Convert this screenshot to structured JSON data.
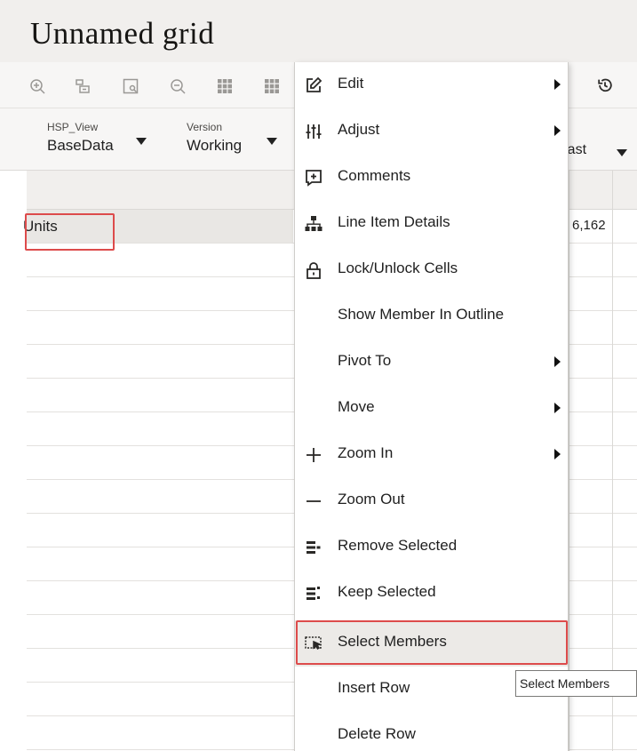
{
  "page": {
    "title": "Unnamed grid"
  },
  "toolbar": {
    "icons": [
      "zoom-in-icon",
      "keep-selected-icon",
      "select-icon",
      "zoom-out-icon",
      "grid-icon",
      "grid-icon",
      "refresh-history-icon"
    ]
  },
  "pov": {
    "items": [
      {
        "label": "HSP_View",
        "value": "BaseData"
      },
      {
        "label": "Version",
        "value": "Working"
      }
    ],
    "partial_value": "East"
  },
  "grid": {
    "row_label": "Units",
    "cell_value": "6,162"
  },
  "context_menu": {
    "items": [
      {
        "label": "Edit",
        "icon": "edit-icon",
        "submenu": true
      },
      {
        "label": "Adjust",
        "icon": "adjust-icon",
        "submenu": true
      },
      {
        "label": "Comments",
        "icon": "comments-icon",
        "submenu": false
      },
      {
        "label": "Line Item Details",
        "icon": "hierarchy-icon",
        "submenu": false
      },
      {
        "label": "Lock/Unlock Cells",
        "icon": "lock-icon",
        "submenu": false
      },
      {
        "label": "Show Member In Outline",
        "icon": "",
        "submenu": false
      },
      {
        "label": "Pivot To",
        "icon": "",
        "submenu": true
      },
      {
        "label": "Move",
        "icon": "",
        "submenu": true
      },
      {
        "label": "Zoom In",
        "icon": "plus-icon",
        "submenu": true
      },
      {
        "label": "Zoom Out",
        "icon": "minus-icon",
        "submenu": false
      },
      {
        "label": "Remove Selected",
        "icon": "remove-selected-icon",
        "submenu": false
      },
      {
        "label": "Keep Selected",
        "icon": "keep-selected-icon",
        "submenu": false
      },
      {
        "label": "Select Members",
        "icon": "select-members-icon",
        "submenu": false,
        "highlighted": true
      },
      {
        "label": "Insert Row",
        "icon": "",
        "submenu": false
      },
      {
        "label": "Delete Row",
        "icon": "",
        "submenu": false
      }
    ]
  },
  "tooltip": {
    "text": "Select Members"
  },
  "colors": {
    "highlight_outline": "#dd4b4b",
    "header_bg": "#f1efed"
  }
}
